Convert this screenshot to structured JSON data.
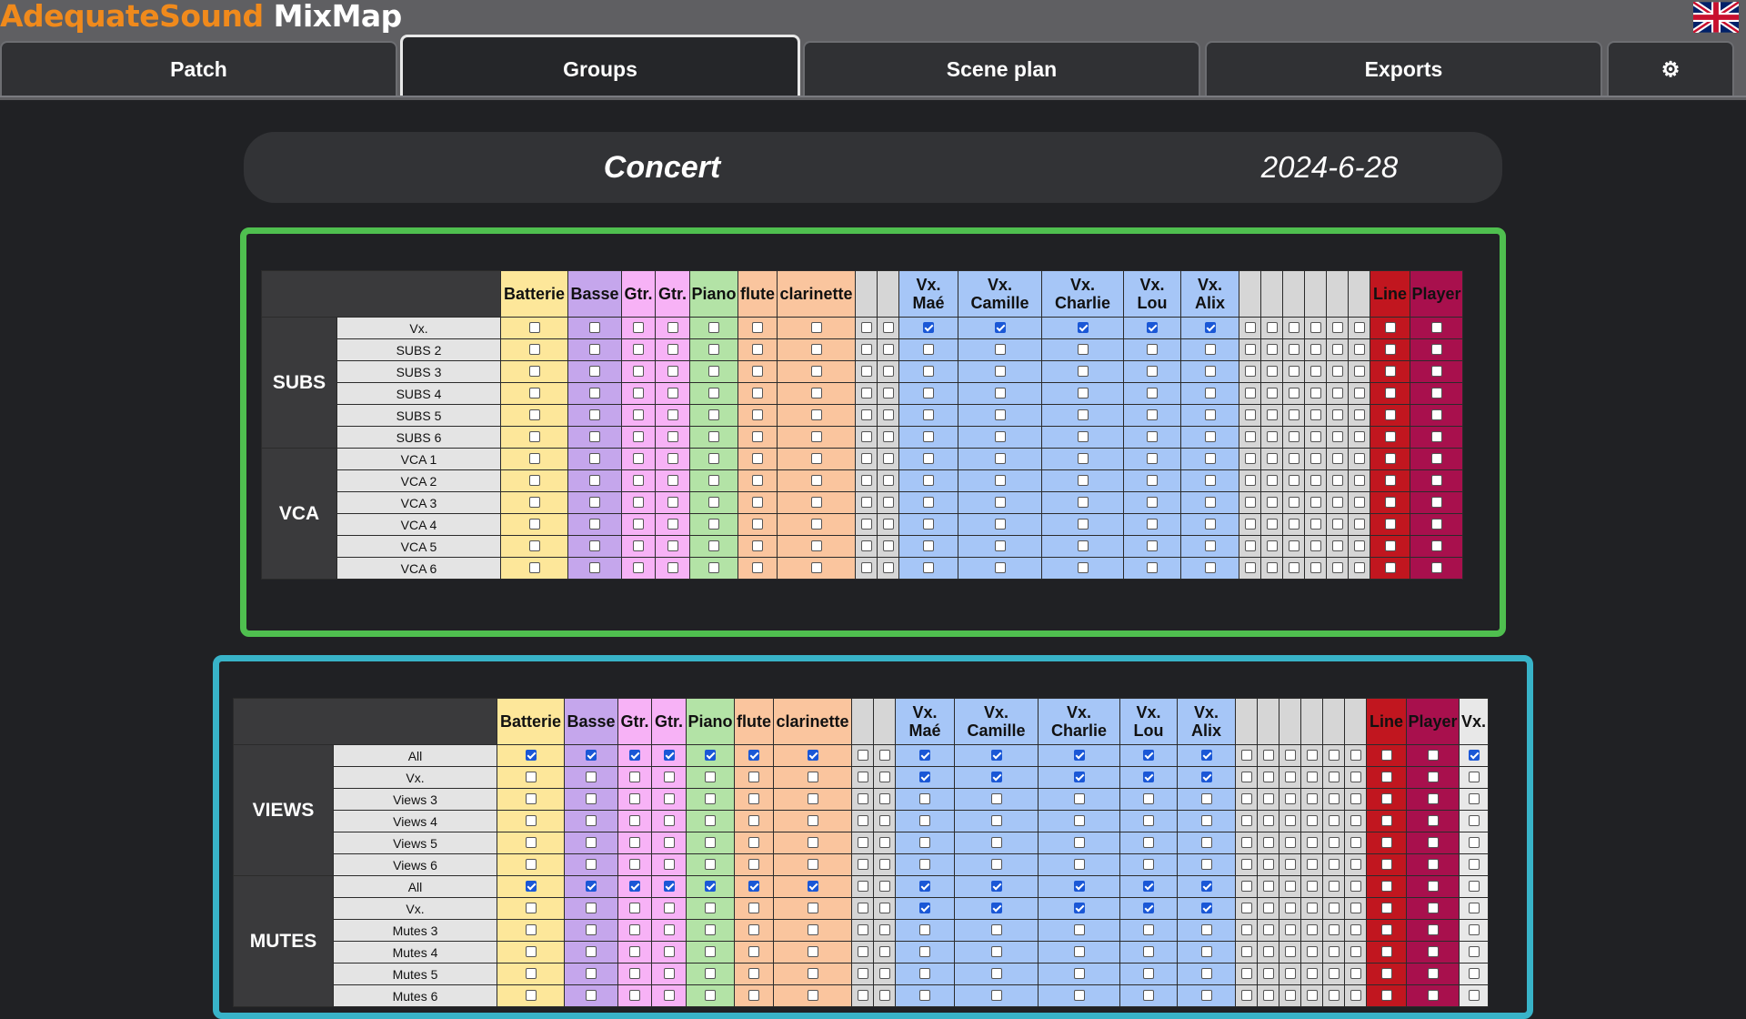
{
  "app": {
    "brand_part1": "AdequateSound",
    "brand_part2": "MixMap"
  },
  "tabs": [
    {
      "label": "Patch"
    },
    {
      "label": "Groups"
    },
    {
      "label": "Scene plan"
    },
    {
      "label": "Exports"
    },
    {
      "label": "⚙"
    }
  ],
  "header": {
    "title": "Concert",
    "date": "2024-6-28"
  },
  "columns": [
    {
      "label": "Batterie",
      "cls": "c-batterie"
    },
    {
      "label": "Basse",
      "cls": "c-basse"
    },
    {
      "label": "Gtr.",
      "cls": "c-gtr"
    },
    {
      "label": "Gtr.",
      "cls": "c-gtr"
    },
    {
      "label": "Piano",
      "cls": "c-piano"
    },
    {
      "label": "flute",
      "cls": "c-flute"
    },
    {
      "label": "clarinette",
      "cls": "c-clarinette"
    },
    {
      "label": "",
      "cls": "c-empty"
    },
    {
      "label": "",
      "cls": "c-empty"
    },
    {
      "label": "Vx.\nMaé",
      "cls": "c-vx"
    },
    {
      "label": "Vx.\nCamille",
      "cls": "c-vx"
    },
    {
      "label": "Vx.\nCharlie",
      "cls": "c-vx"
    },
    {
      "label": "Vx.\nLou",
      "cls": "c-vx"
    },
    {
      "label": "Vx.\nAlix",
      "cls": "c-vx"
    },
    {
      "label": "",
      "cls": "c-empty"
    },
    {
      "label": "",
      "cls": "c-empty"
    },
    {
      "label": "",
      "cls": "c-empty"
    },
    {
      "label": "",
      "cls": "c-empty"
    },
    {
      "label": "",
      "cls": "c-empty"
    },
    {
      "label": "",
      "cls": "c-empty"
    },
    {
      "label": "Line",
      "cls": "c-line"
    },
    {
      "label": "Player",
      "cls": "c-player"
    }
  ],
  "extra_column_blue": {
    "label": "Vx.",
    "cls": "c-vxgrp"
  },
  "panels": [
    {
      "id": "green",
      "groups": [
        {
          "label": "SUBS",
          "rows": [
            {
              "label": "Vx.",
              "checked": [
                9,
                10,
                11,
                12,
                13
              ]
            },
            {
              "label": "SUBS 2",
              "checked": []
            },
            {
              "label": "SUBS 3",
              "checked": []
            },
            {
              "label": "SUBS 4",
              "checked": []
            },
            {
              "label": "SUBS 5",
              "checked": []
            },
            {
              "label": "SUBS 6",
              "checked": []
            }
          ]
        },
        {
          "label": "VCA",
          "rows": [
            {
              "label": "VCA 1",
              "checked": []
            },
            {
              "label": "VCA 2",
              "checked": []
            },
            {
              "label": "VCA 3",
              "checked": []
            },
            {
              "label": "VCA 4",
              "checked": []
            },
            {
              "label": "VCA 5",
              "checked": []
            },
            {
              "label": "VCA 6",
              "checked": []
            }
          ]
        }
      ]
    },
    {
      "id": "blue",
      "groups": [
        {
          "label": "VIEWS",
          "rows": [
            {
              "label": "All",
              "checked": [
                0,
                1,
                2,
                3,
                4,
                5,
                6,
                9,
                10,
                11,
                12,
                13,
                22
              ]
            },
            {
              "label": "Vx.",
              "checked": [
                9,
                10,
                11,
                12,
                13
              ]
            },
            {
              "label": "Views 3",
              "checked": []
            },
            {
              "label": "Views 4",
              "checked": []
            },
            {
              "label": "Views 5",
              "checked": []
            },
            {
              "label": "Views 6",
              "checked": []
            }
          ]
        },
        {
          "label": "MUTES",
          "rows": [
            {
              "label": "All",
              "checked": [
                0,
                1,
                2,
                3,
                4,
                5,
                6,
                9,
                10,
                11,
                12,
                13
              ]
            },
            {
              "label": "Vx.",
              "checked": [
                9,
                10,
                11,
                12,
                13
              ]
            },
            {
              "label": "Mutes 3",
              "checked": []
            },
            {
              "label": "Mutes 4",
              "checked": []
            },
            {
              "label": "Mutes 5",
              "checked": []
            },
            {
              "label": "Mutes 6",
              "checked": []
            }
          ]
        }
      ]
    }
  ]
}
